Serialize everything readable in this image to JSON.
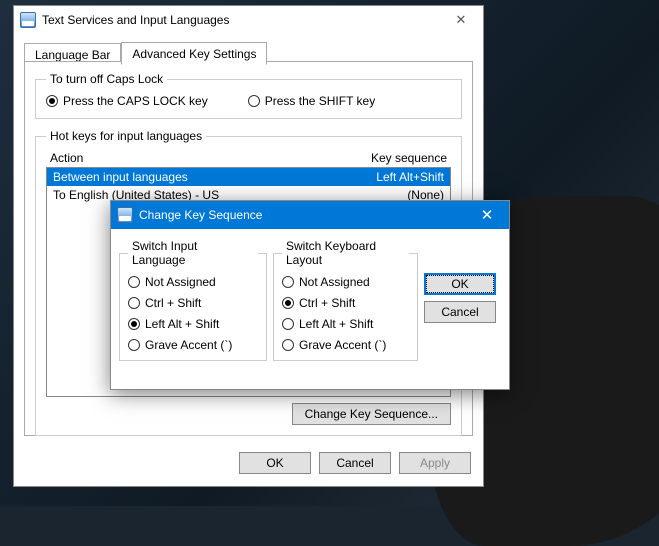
{
  "main": {
    "title": "Text Services and Input Languages",
    "tabs": {
      "lang_bar": "Language Bar",
      "advanced": "Advanced Key Settings"
    },
    "capslock": {
      "legend": "To turn off Caps Lock",
      "opt_caps": "Press the CAPS LOCK key",
      "opt_shift": "Press the SHIFT key",
      "selected": "opt_caps"
    },
    "hotkeys": {
      "legend": "Hot keys for input languages",
      "header_action": "Action",
      "header_key": "Key sequence",
      "rows": [
        {
          "action": "Between input languages",
          "key": "Left Alt+Shift",
          "selected": true
        },
        {
          "action": "To English (United States) - US",
          "key": "(None)",
          "selected": false
        }
      ],
      "change_btn": "Change Key Sequence..."
    },
    "buttons": {
      "ok": "OK",
      "cancel": "Cancel",
      "apply": "Apply"
    }
  },
  "modal": {
    "title": "Change Key Sequence",
    "input_lang": {
      "legend": "Switch Input Language",
      "not_assigned": "Not Assigned",
      "ctrl_shift": "Ctrl + Shift",
      "left_alt_shift": "Left Alt + Shift",
      "grave": "Grave Accent (`)",
      "selected": "left_alt_shift"
    },
    "kbd_layout": {
      "legend": "Switch Keyboard Layout",
      "not_assigned": "Not Assigned",
      "ctrl_shift": "Ctrl + Shift",
      "left_alt_shift": "Left Alt + Shift",
      "grave": "Grave Accent (`)",
      "selected": "ctrl_shift"
    },
    "buttons": {
      "ok": "OK",
      "cancel": "Cancel"
    }
  }
}
